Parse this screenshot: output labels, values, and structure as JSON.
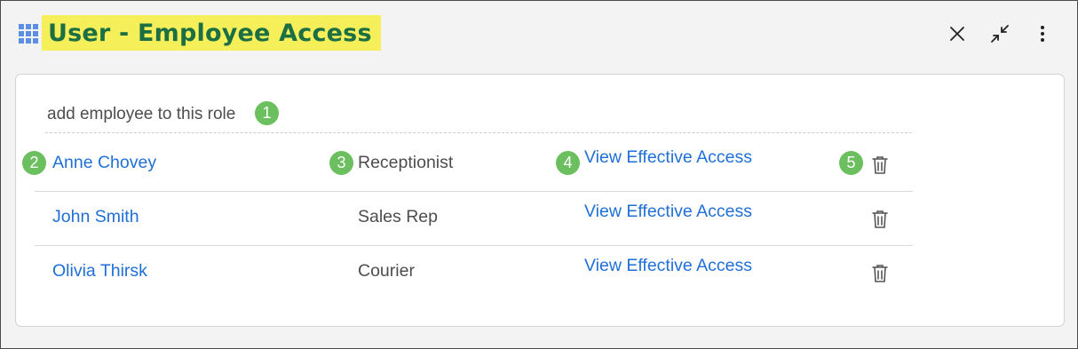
{
  "window": {
    "title": "User - Employee Access",
    "grid_icon": "grid-icon",
    "controls": [
      "close-icon",
      "collapse-icon",
      "more-vertical-icon"
    ],
    "title_highlight_color": "#f5ef5a",
    "title_color": "#1c6e43"
  },
  "panel": {
    "add_label": "add employee to this role",
    "rows": [
      {
        "employee": "Anne Chovey",
        "role": "Receptionist",
        "action": "View Effective Access",
        "delete_icon": "trash-icon"
      },
      {
        "employee": "John Smith",
        "role": "Sales Rep",
        "action": "View Effective Access",
        "delete_icon": "trash-icon"
      },
      {
        "employee": "Olivia Thirsk",
        "role": "Courier",
        "action": "View Effective Access",
        "delete_icon": "trash-icon"
      }
    ]
  },
  "callouts": {
    "color": "#6bbf5e",
    "labels": [
      "1",
      "2",
      "3",
      "4",
      "5"
    ]
  },
  "colors": {
    "link": "#1f6fd6",
    "text": "#4d4d4d"
  }
}
